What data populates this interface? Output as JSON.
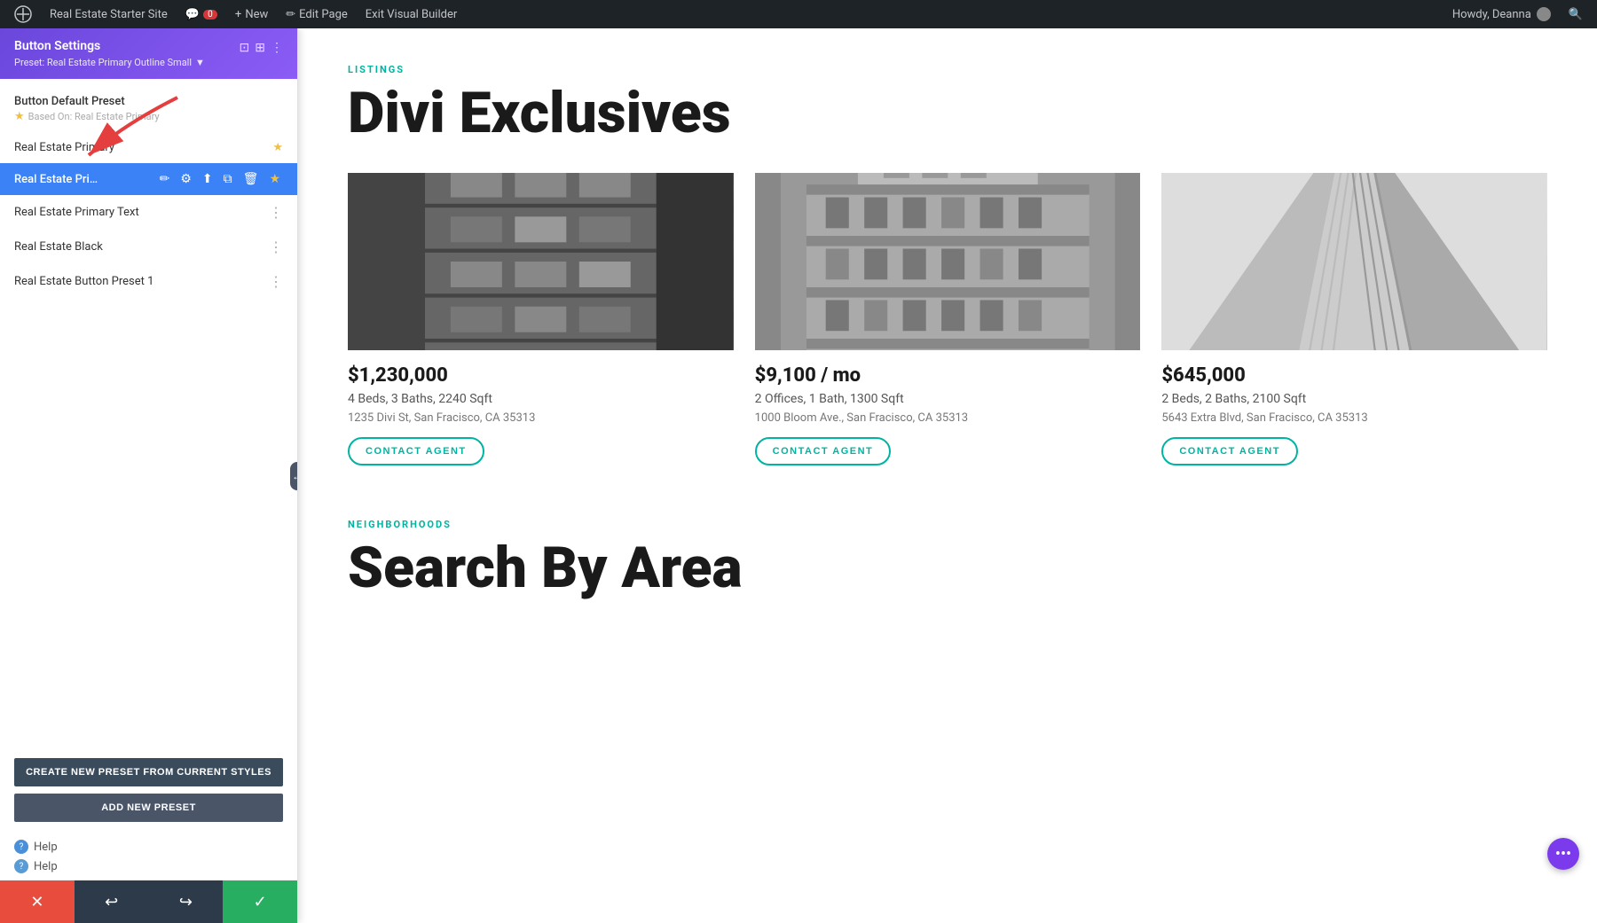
{
  "adminBar": {
    "siteName": "Real Estate Starter Site",
    "commentCount": "0",
    "newLabel": "New",
    "editPage": "Edit Page",
    "exitBuilder": "Exit Visual Builder",
    "howdy": "Howdy, Deanna"
  },
  "panel": {
    "title": "Button Settings",
    "presetLabel": "Preset: Real Estate Primary Outline Small",
    "presetDropdownArrow": "▼",
    "defaultPreset": {
      "name": "Button Default Preset",
      "basedOn": "Based On: Real Estate Primary"
    },
    "presets": [
      {
        "id": "real-estate-primary",
        "name": "Real Estate Primary",
        "starred": true,
        "active": false
      },
      {
        "id": "real-estate-primary-outline-small",
        "name": "Real Estate Primar...",
        "starred": true,
        "active": true
      },
      {
        "id": "real-estate-primary-text",
        "name": "Real Estate Primary Text",
        "starred": false,
        "active": false
      },
      {
        "id": "real-estate-black",
        "name": "Real Estate Black",
        "starred": false,
        "active": false
      },
      {
        "id": "real-estate-button-preset-1",
        "name": "Real Estate Button Preset 1",
        "starred": false,
        "active": false
      }
    ],
    "createButton": "CREATE NEW PRESET FROM CURRENT STYLES",
    "addButton": "ADD NEW PRESET",
    "helpLinks": [
      {
        "label": "Help"
      },
      {
        "label": "Help"
      }
    ]
  },
  "listings": {
    "sectionLabel": "LISTINGS",
    "sectionTitle": "Divi Exclusives",
    "cards": [
      {
        "price": "$1,230,000",
        "details": "4 Beds, 3 Baths, 2240 Sqft",
        "address": "1235 Divi St, San Fracisco, CA 35313",
        "btnLabel": "CONTACT AGENT"
      },
      {
        "price": "$9,100 / mo",
        "details": "2 Offices, 1 Bath, 1300 Sqft",
        "address": "1000 Bloom Ave., San Fracisco, CA 35313",
        "btnLabel": "CONTACT AGENT"
      },
      {
        "price": "$645,000",
        "details": "2 Beds, 2 Baths, 2100 Sqft",
        "address": "5643 Extra Blvd, San Fracisco, CA 35313",
        "btnLabel": "CONTACT AGENT"
      }
    ]
  },
  "neighborhoods": {
    "sectionLabel": "NEIGHBORHOODS",
    "sectionTitle": "Search By Area"
  },
  "colors": {
    "accent": "#00b4a2",
    "purple": "#7c3aed",
    "blue": "#3b82f6"
  }
}
